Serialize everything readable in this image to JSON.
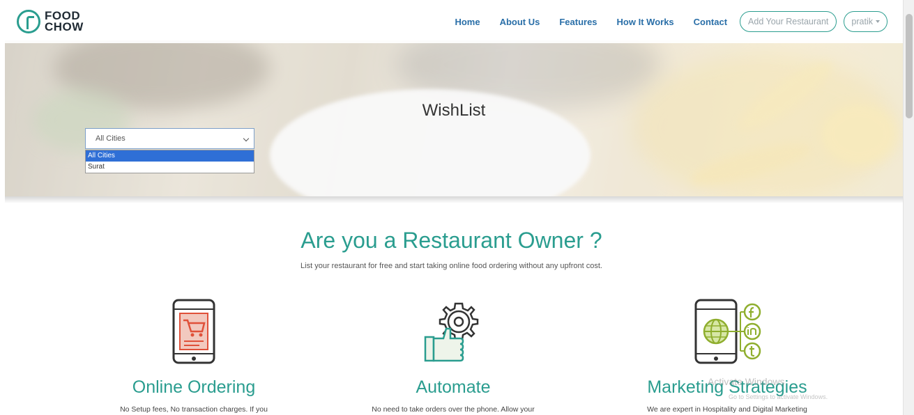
{
  "brand": {
    "line1": "FOOD",
    "line2": "CHOW"
  },
  "nav": {
    "links": [
      "Home",
      "About Us",
      "Features",
      "How It Works",
      "Contact"
    ],
    "add_restaurant": "Add Your Restaurant",
    "user": "pratik"
  },
  "hero": {
    "title": "WishList",
    "city_select": {
      "value": "All Cities",
      "options": [
        "All Cities",
        "Surat"
      ],
      "highlighted": "All Cities"
    }
  },
  "owner": {
    "title": "Are you a Restaurant Owner ?",
    "subtitle": "List your restaurant for free and start taking online food ordering without any upfront cost.",
    "features": [
      {
        "title": "Online Ordering",
        "desc": "No Setup fees, No transaction charges. If you",
        "icon": "mobile-cart-icon"
      },
      {
        "title": "Automate",
        "desc": "No need to take orders over the phone. Allow your",
        "icon": "gear-thumbs-up-icon"
      },
      {
        "title": "Marketing Strategies",
        "desc": "We are expert in Hospitality and Digital Marketing",
        "icon": "mobile-social-icon"
      }
    ]
  },
  "watermark": {
    "line1": "Activate Windows",
    "line2": "Go to Settings to activate Windows."
  },
  "colors": {
    "accent": "#2a9d8f",
    "nav_link": "#2a6fa8",
    "select_highlight": "#2f6fd6"
  }
}
